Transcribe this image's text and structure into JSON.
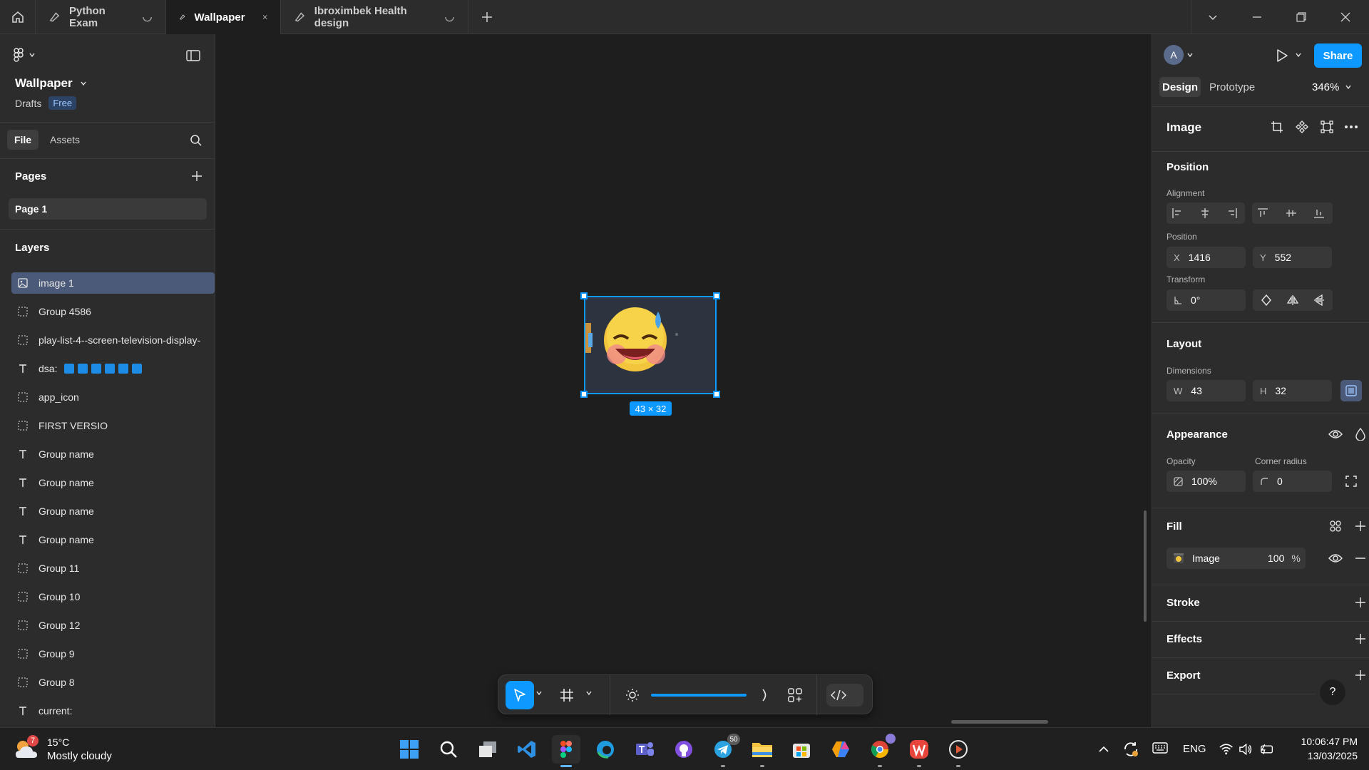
{
  "tabs": [
    {
      "label": "Python Exam",
      "loading": true
    },
    {
      "label": "Wallpaper",
      "active": true
    },
    {
      "label": "Ibroximbek Health design",
      "loading": true
    }
  ],
  "file": {
    "name": "Wallpaper",
    "location": "Drafts",
    "plan": "Free"
  },
  "left_tabs": {
    "file": "File",
    "assets": "Assets"
  },
  "pages": {
    "title": "Pages",
    "items": [
      "Page 1"
    ]
  },
  "layers": {
    "title": "Layers",
    "items": [
      {
        "type": "image",
        "name": "image 1",
        "selected": true
      },
      {
        "type": "group",
        "name": "Group 4586"
      },
      {
        "type": "group",
        "name": "play-list-4--screen-television-display-"
      },
      {
        "type": "text",
        "name": "dsa:"
      },
      {
        "type": "group",
        "name": "app_icon"
      },
      {
        "type": "group",
        "name": "FIRST VERSIO"
      },
      {
        "type": "text",
        "name": "Group name"
      },
      {
        "type": "text",
        "name": "Group name"
      },
      {
        "type": "text",
        "name": "Group name"
      },
      {
        "type": "text",
        "name": "Group name"
      },
      {
        "type": "group",
        "name": "Group 11"
      },
      {
        "type": "group",
        "name": "Group 10"
      },
      {
        "type": "group",
        "name": "Group 12"
      },
      {
        "type": "group",
        "name": "Group 9"
      },
      {
        "type": "group",
        "name": "Group 8"
      },
      {
        "type": "text",
        "name": "current:"
      }
    ]
  },
  "canvas": {
    "selection_size": "43 × 32"
  },
  "header": {
    "avatar": "A",
    "share": "Share",
    "design_tab": "Design",
    "prototype_tab": "Prototype",
    "zoom": "346%"
  },
  "design": {
    "selection_title": "Image",
    "position": {
      "title": "Position",
      "alignment_label": "Alignment",
      "position_label": "Position",
      "x_label": "X",
      "x": "1416",
      "y_label": "Y",
      "y": "552",
      "transform_label": "Transform",
      "rotation": "0°"
    },
    "layout": {
      "title": "Layout",
      "dimensions_label": "Dimensions",
      "w_label": "W",
      "w": "43",
      "h_label": "H",
      "h": "32"
    },
    "appearance": {
      "title": "Appearance",
      "opacity_label": "Opacity",
      "opacity": "100%",
      "radius_label": "Corner radius",
      "radius": "0"
    },
    "fill": {
      "title": "Fill",
      "type": "Image",
      "opacity": "100",
      "unit": "%"
    },
    "stroke": {
      "title": "Stroke"
    },
    "effects": {
      "title": "Effects"
    },
    "export": {
      "title": "Export"
    },
    "help": "?"
  },
  "taskbar": {
    "weather": {
      "temp": "15°C",
      "desc": "Mostly cloudy",
      "badge": "7"
    },
    "telegram_badge": "50",
    "lang": "ENG",
    "time": "10:06:47 PM",
    "date": "13/03/2025"
  },
  "colors": {
    "accent": "#0d99ff",
    "canvas": "#1e1e1e",
    "panel": "#2c2c2c",
    "selected_layer": "#4a5a78"
  }
}
